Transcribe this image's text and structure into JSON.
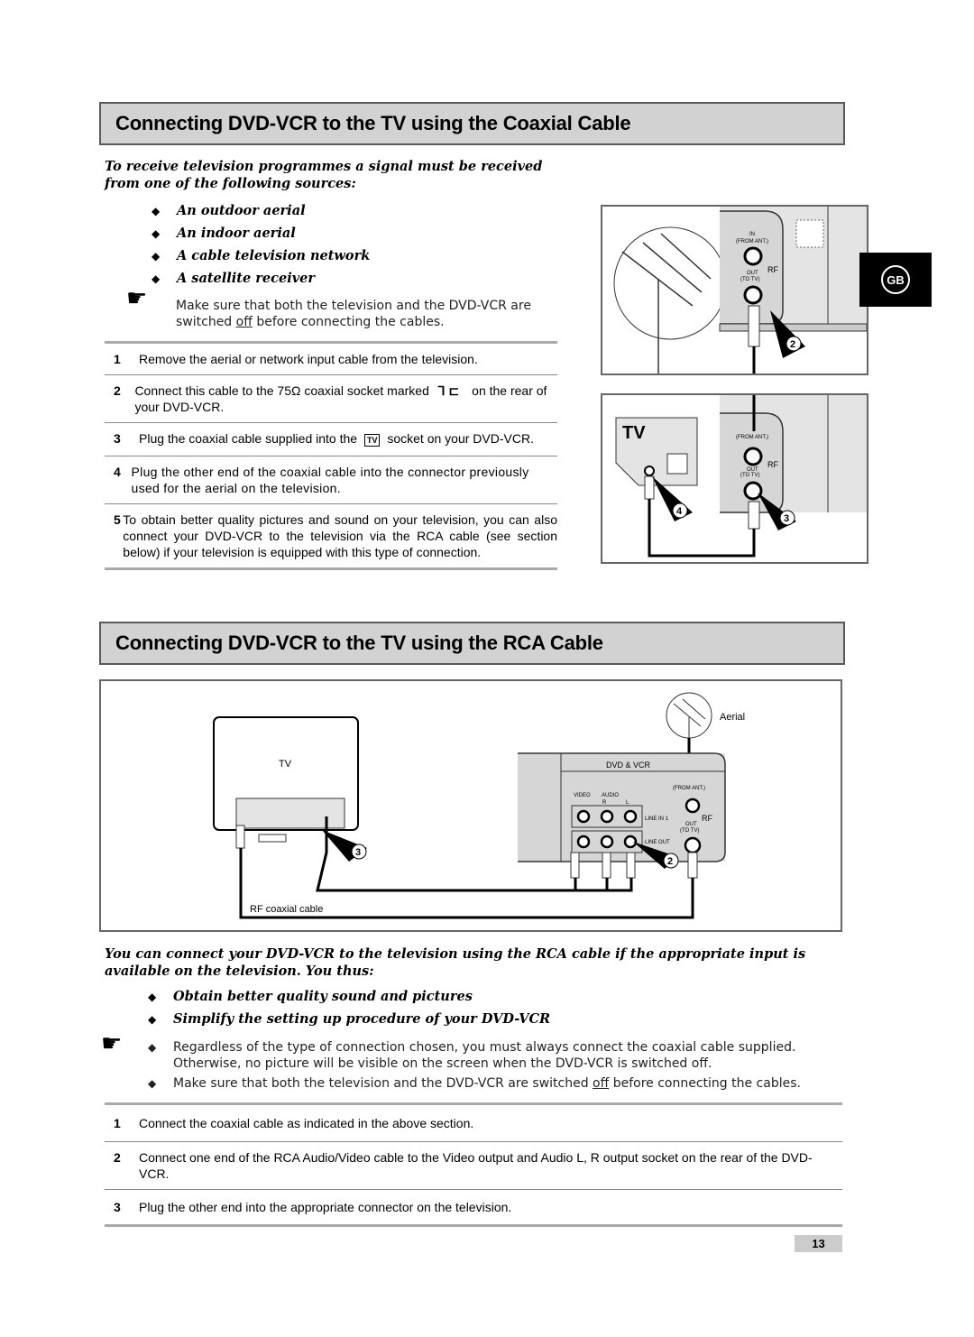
{
  "section1": {
    "title": "Connecting DVD-VCR to the TV using the Coaxial Cable",
    "intro": "To receive television programmes a signal must be received from one of the following sources:",
    "bullets": [
      "An outdoor aerial",
      "An indoor aerial",
      "A cable television network",
      "A satellite receiver"
    ],
    "note": {
      "before": "Make sure that both the television and the DVD-VCR are switched ",
      "underlined": "off",
      "after": " before connecting the cables."
    },
    "steps": [
      {
        "n": "1",
        "text": "Remove the aerial or network input cable from the television."
      },
      {
        "n": "2",
        "text": "Connect this cable to the 75Ω coaxial socket marked",
        "symbol": "⅂⊏",
        "text2": "on the rear of your DVD-VCR."
      },
      {
        "n": "3",
        "text": "Plug the coaxial cable supplied into the",
        "symbol": "TV",
        "text2": "socket on your DVD-VCR."
      },
      {
        "n": "4",
        "text": "Plug the other end of the coaxial cable into the connector previously used for the aerial on the television."
      },
      {
        "n": "5",
        "text": "To obtain better quality pictures and sound on your television, you can also connect your DVD-VCR to the television via the RCA cable (see section below) if your television is equipped with this type of connection."
      }
    ],
    "figure_top": {
      "in": "IN",
      "from_ant": "(FROM ANT.)",
      "rf": "RF",
      "out": "OUT",
      "to_tv": "(TO TV)",
      "callout": "2"
    },
    "figure_bottom": {
      "tv": "TV",
      "from_ant": "(FROM ANT.)",
      "rf": "RF",
      "out": "OUT",
      "to_tv": "(TO TV)",
      "callout_a": "4",
      "callout_b": "3"
    }
  },
  "language_tab": "GB",
  "section2": {
    "title": "Connecting DVD-VCR to the TV using the RCA Cable",
    "figure": {
      "aerial": "Aerial",
      "tv": "TV",
      "dvd_vcr": "DVD & VCR",
      "video": "VIDEO",
      "audio": "AUDIO",
      "r": "R",
      "l": "L",
      "line_in": "LINE IN 1",
      "line_out": "LINE OUT",
      "from_ant": "(FROM ANT.)",
      "out": "OUT",
      "to_tv": "(TO TV)",
      "rf": "RF",
      "callout_a": "3",
      "callout_b": "2",
      "cable": "RF coaxial cable"
    },
    "intro": "You can connect your DVD-VCR to the television using the RCA cable if the appropriate input is available on the television. You thus:",
    "bullets": [
      "Obtain better quality sound and pictures",
      "Simplify the setting up procedure of your DVD-VCR"
    ],
    "notes": [
      {
        "text": "Regardless of the type of connection chosen, you must always connect the coaxial cable supplied. Otherwise, no picture will be visible on the screen when the DVD-VCR is switched off."
      },
      {
        "before": "Make sure that both the television and the DVD-VCR are switched ",
        "underlined": "off",
        "after": " before connecting the cables."
      }
    ],
    "steps": [
      {
        "n": "1",
        "text": "Connect the coaxial cable as indicated in the above section."
      },
      {
        "n": "2",
        "text": "Connect one end of the RCA Audio/Video cable to the Video output and Audio L, R output socket on the rear of the DVD-VCR."
      },
      {
        "n": "3",
        "text": "Plug the other end into the appropriate connector on the television."
      }
    ]
  },
  "page_number": "13"
}
